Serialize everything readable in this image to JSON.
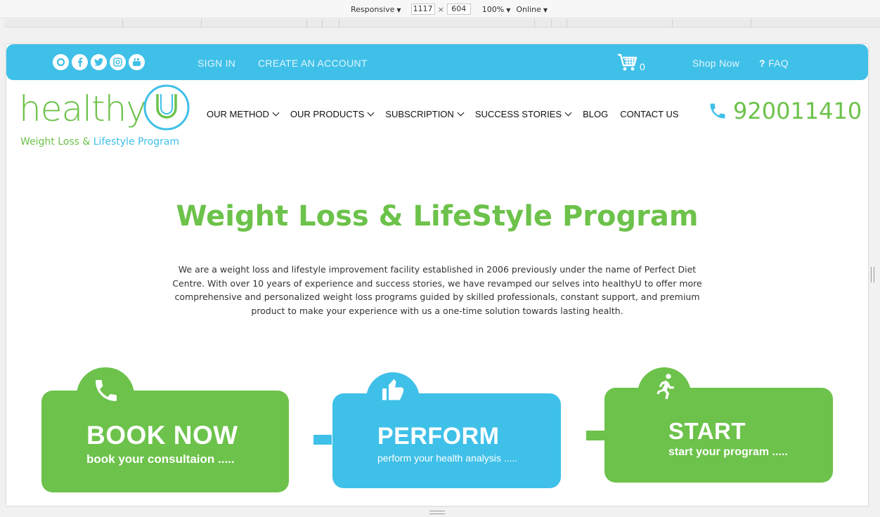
{
  "devtools": {
    "device_label": "Responsive",
    "width": "1117",
    "height": "604",
    "zoom": "100%",
    "network": "Online"
  },
  "topbar": {
    "social_icons": [
      "instagram-icon",
      "facebook-icon",
      "twitter-icon",
      "instagram-alt-icon",
      "youtube-icon"
    ],
    "sign_in": "SIGN IN",
    "create_account": "CREATE AN ACCOUNT",
    "cart_count": "0",
    "shop_now": "Shop Now",
    "faq_icon": "?",
    "faq": "FAQ"
  },
  "logo": {
    "word": "healthy",
    "tagline_a": "Weight Loss & ",
    "tagline_b": "Lifestyle Program"
  },
  "nav": {
    "items": [
      "OUR METHOD",
      "OUR PRODUCTS",
      "SUBSCRIPTION",
      "SUCCESS STORIES",
      "BLOG",
      "CONTACT US"
    ]
  },
  "phone": "920011410",
  "hero": {
    "title": "Weight Loss & LifeStyle Program",
    "text": "We are a weight loss and lifestyle improvement facility established in 2006 previously under the name of Perfect Diet Centre. With over 10 years of experience and success stories, we have revamped our selves into healthyU to offer more comprehensive and personalized weight loss programs guided by skilled professionals, constant support, and premium product to make your experience with us a one-time solution towards lasting health."
  },
  "steps": [
    {
      "title": "BOOK NOW",
      "subtitle": "book your consultaion .....",
      "icon": "phone-icon"
    },
    {
      "title": "PERFORM",
      "subtitle": "perform your health analysis .....",
      "icon": "thumbs-up-icon"
    },
    {
      "title": "START",
      "subtitle": "start your program .....",
      "icon": "running-icon"
    }
  ],
  "colors": {
    "green": "#6cc24a",
    "blue": "#3fc0e8"
  }
}
